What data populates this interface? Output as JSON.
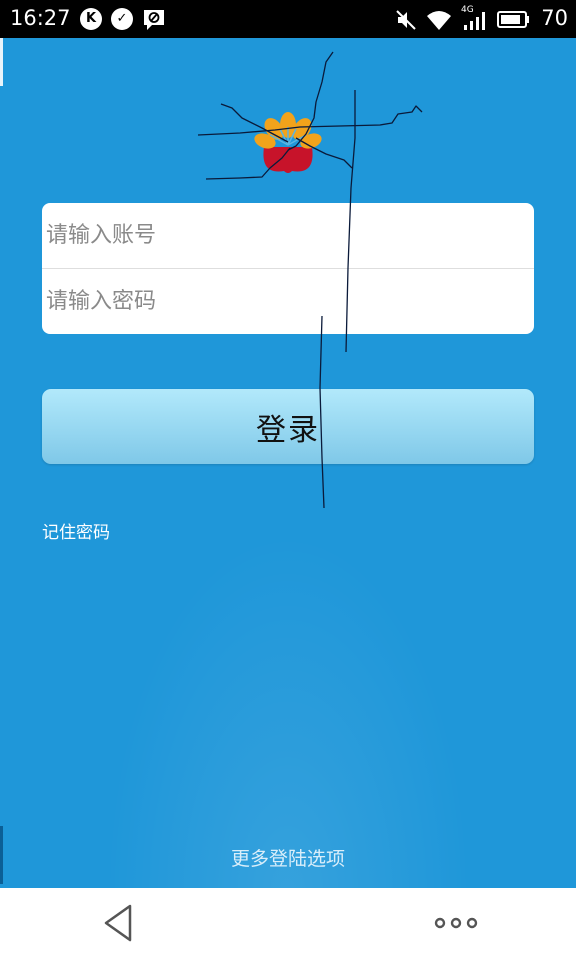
{
  "status_bar": {
    "time": "16:27",
    "icons": [
      "k-icon",
      "check-icon",
      "blocked-message-icon"
    ],
    "right_icons": [
      "mute-icon",
      "wifi-icon",
      "signal-4g-icon",
      "battery-icon"
    ],
    "network_label": "4G",
    "battery": "70"
  },
  "login": {
    "account_placeholder": "请输入账号",
    "password_placeholder": "请输入密码",
    "login_label": "登录",
    "remember_label": "记住密码",
    "more_options_label": "更多登陆选项"
  },
  "colors": {
    "background": "#1f97d9",
    "button": "#9edbf3",
    "status_bar": "#000000"
  }
}
